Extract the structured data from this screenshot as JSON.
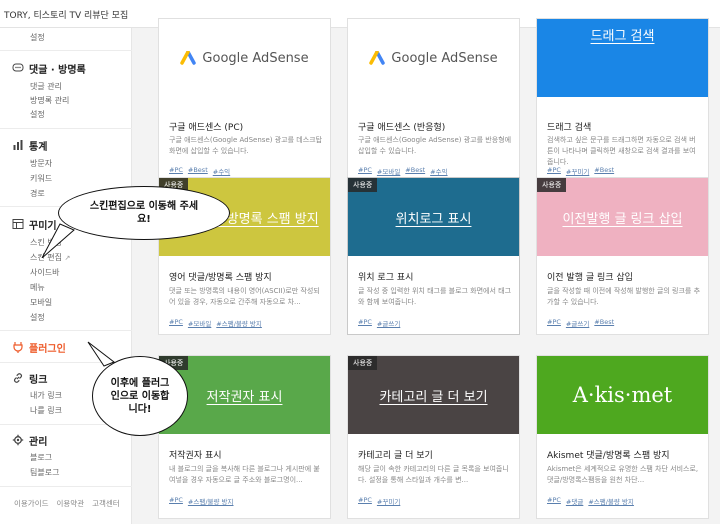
{
  "topbar": {
    "title": "TORY, 티스토리 TV 리뷰단 모집"
  },
  "sidebar": {
    "top_item": "설정",
    "sections": [
      {
        "title": "댓글 · 방명록",
        "icon": "comment-icon",
        "items": [
          "댓글 관리",
          "방명록 관리",
          "설정"
        ]
      },
      {
        "title": "통계",
        "icon": "stats-icon",
        "items": [
          "방문자",
          "키워드",
          "경로"
        ]
      },
      {
        "title": "꾸미기",
        "icon": "skin-icon",
        "items": [
          "스킨 변경",
          "스킨 편집",
          "사이드바",
          "메뉴",
          "모바일",
          "설정"
        ]
      },
      {
        "title": "플러그인",
        "icon": "plugin-icon",
        "items": []
      },
      {
        "title": "링크",
        "icon": "link-icon",
        "items": [
          "내가 링크",
          "나를 링크"
        ]
      },
      {
        "title": "관리",
        "icon": "gear-icon",
        "items": [
          "블로그",
          "팀블로그"
        ]
      }
    ],
    "footer": [
      "이용가이드",
      "이용약관",
      "고객센터"
    ]
  },
  "cards": [
    {
      "thumb": "Google AdSense",
      "badge": "",
      "title": "구글 애드센스 (PC)",
      "desc": "구글 애드센스(Google AdSense) 광고를 데스크탑 화면에 삽입할 수 있습니다.",
      "tags": [
        "#PC",
        "#Best",
        "#수익"
      ]
    },
    {
      "thumb": "Google AdSense",
      "badge": "",
      "title": "구글 애드센스 (반응형)",
      "desc": "구글 애드센스(Google AdSense) 광고를 반응형에 삽입할 수 있습니다.",
      "tags": [
        "#PC",
        "#모바일",
        "#Best",
        "#수익"
      ]
    },
    {
      "thumb": "드래그 검색",
      "badge": "",
      "title": "드래그 검색",
      "desc": "검색하고 싶은 문구를 드래그하면 자동으로 검색 버튼이 나타나며 클릭하면 새창으로 검색 결과를 보여줍니다.",
      "tags": [
        "#PC",
        "#꾸미기",
        "#Best"
      ]
    },
    {
      "thumb": "영어 댓글/방명록 스팸 방지",
      "badge": "사용중",
      "title": "영어 댓글/방명록 스팸 방지",
      "desc": "댓글 또는 방명록의 내용이 영어(ASCII)로만 작성되어 있을 경우, 자동으로 간주해 자동으로 차...",
      "tags": [
        "#PC",
        "#모바일",
        "#스팸/불량 방지"
      ]
    },
    {
      "thumb": "위치로그 표시",
      "badge": "사용중",
      "title": "위치 로그 표시",
      "desc": "글 작성 중 입력한 위치 태그를 블로그 화면에서 태그와 함께 보여줍니다.",
      "tags": [
        "#PC",
        "#글쓰기"
      ]
    },
    {
      "thumb": "이전발행 글 링크 삽입",
      "badge": "사용중",
      "title": "이전 발행 글 링크 삽입",
      "desc": "글을 작성할 때 이전에 작성해 발행한 글의 링크를 추가할 수 있습니다.",
      "tags": [
        "#PC",
        "#글쓰기",
        "#Best"
      ]
    },
    {
      "thumb": "저작권자 표시",
      "badge": "사용중",
      "title": "저작권자 표시",
      "desc": "내 블로그의 글을 복사해 다른 블로그나 게시판에 붙여넣을 경우 자동으로 글 주소와 블로그명이...",
      "tags": [
        "#PC",
        "#스팸/불량 방지"
      ]
    },
    {
      "thumb": "카테고리 글 더 보기",
      "badge": "사용중",
      "title": "카테고리 글 더 보기",
      "desc": "해당 글이 속한 카테고리의 다른 글 목록을 보여줍니다. 설정을 통해 스타일과 개수를 변...",
      "tags": [
        "#PC",
        "#꾸미기"
      ]
    },
    {
      "thumb": "A·kis·met",
      "badge": "",
      "title": "Akismet 댓글/방명록 스팸 방지",
      "desc": "Akismet은 세계적으로 유명한 스팸 차단 서비스로, 댓글/방명록스팸등을 원천 차단...",
      "tags": [
        "#PC",
        "#댓글",
        "#스팸/불량 방지"
      ]
    }
  ],
  "bubbles": {
    "first": "스킨편집으로 이동해 주세요!",
    "second": "이후에 플러그인으로 이동합니다!"
  },
  "colors": {
    "accent": "#ee5b2a",
    "blue": "#1a86e6",
    "olive": "#cdc63f",
    "teal": "#1e6c8f",
    "pink": "#efb1c1",
    "green": "#59a84a",
    "dark": "#4a4444",
    "lime": "#4ea81f"
  }
}
